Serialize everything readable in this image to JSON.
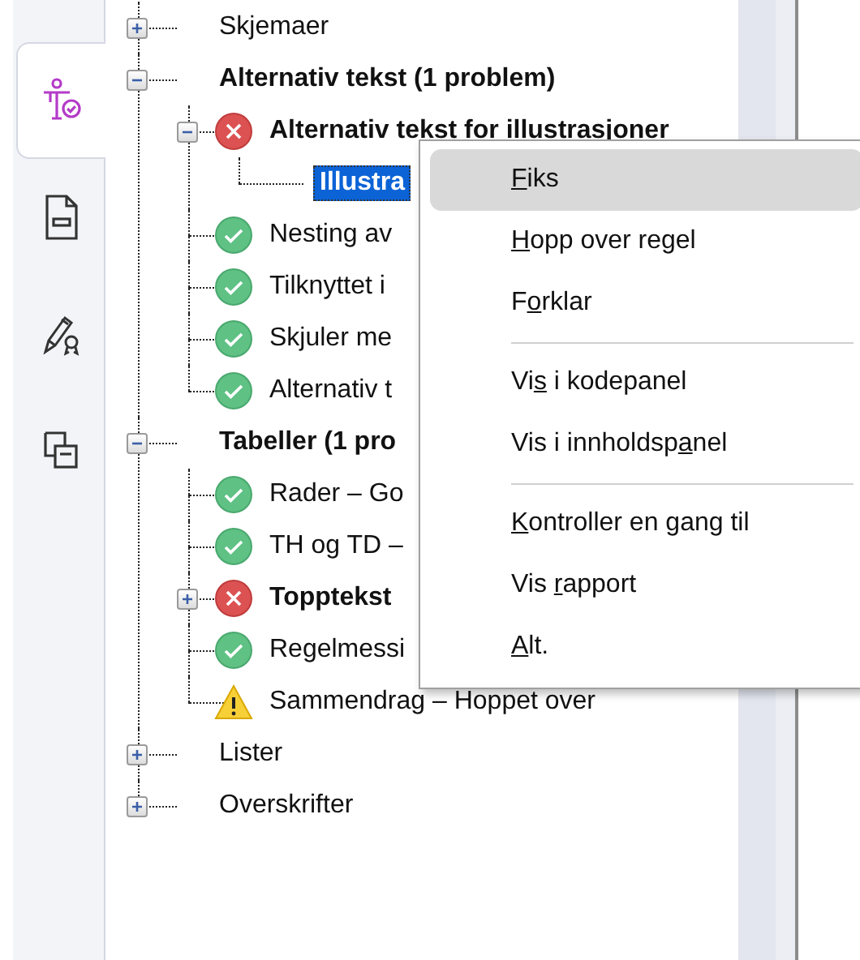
{
  "sidebar": {
    "tabs": [
      {
        "kind": "accessibility",
        "selected": true
      },
      {
        "kind": "document",
        "selected": false
      },
      {
        "kind": "signature",
        "selected": false
      },
      {
        "kind": "copy",
        "selected": false
      }
    ]
  },
  "tree": {
    "items": [
      {
        "label": "Skjemaer",
        "bold": false,
        "selected": false,
        "expanded": false
      },
      {
        "label": "Alternativ tekst (1 problem)",
        "bold": true,
        "selected": false,
        "expanded": true,
        "children": [
          {
            "label": "Alternativ tekst for illustrasjoner",
            "bold": true,
            "selected": false,
            "kind": "fail",
            "expanded": true,
            "children": [
              {
                "label": "Illustra",
                "bold": true,
                "selected": true
              }
            ]
          },
          {
            "label": "Nesting av",
            "bold": false,
            "selected": false,
            "kind": "pass"
          },
          {
            "label": "Tilknyttet i",
            "bold": false,
            "selected": false,
            "kind": "pass"
          },
          {
            "label": "Skjuler me",
            "bold": false,
            "selected": false,
            "kind": "pass"
          },
          {
            "label": "Alternativ t",
            "bold": false,
            "selected": false,
            "kind": "pass"
          }
        ]
      },
      {
        "label": "Tabeller (1 pro",
        "bold": true,
        "selected": false,
        "expanded": true,
        "children": [
          {
            "label": "Rader – Go",
            "bold": false,
            "selected": false,
            "kind": "pass"
          },
          {
            "label": "TH og TD –",
            "bold": false,
            "selected": false,
            "kind": "pass"
          },
          {
            "label": "Topptekst",
            "bold": true,
            "selected": false,
            "kind": "fail",
            "expanded": false
          },
          {
            "label": "Regelmessi",
            "bold": false,
            "selected": false,
            "kind": "pass"
          },
          {
            "label": "Sammendrag – Hoppet over",
            "bold": false,
            "selected": false,
            "kind": "warning"
          }
        ]
      },
      {
        "label": "Lister",
        "bold": false,
        "selected": false,
        "expanded": false
      },
      {
        "label": "Overskrifter",
        "bold": false,
        "selected": false,
        "expanded": false
      }
    ]
  },
  "context_menu": {
    "items": [
      {
        "kind": "item",
        "key": "F",
        "after": "iks",
        "highlighted": true
      },
      {
        "kind": "item",
        "key": "H",
        "after": "opp over regel",
        "highlighted": false
      },
      {
        "kind": "item",
        "before": "F",
        "key": "o",
        "after": "rklar",
        "highlighted": false
      },
      {
        "kind": "separator"
      },
      {
        "kind": "item",
        "before": "Vi",
        "key": "s",
        "after": " i kodepanel",
        "highlighted": false
      },
      {
        "kind": "item",
        "before": "Vis i innholdsp",
        "key": "a",
        "after": "nel",
        "highlighted": false
      },
      {
        "kind": "separator"
      },
      {
        "kind": "item",
        "key": "K",
        "after": "ontroller en gang til",
        "highlighted": false
      },
      {
        "kind": "item",
        "before": "Vis ",
        "key": "r",
        "after": "apport",
        "highlighted": false
      },
      {
        "kind": "item",
        "key": "A",
        "after": "lt.",
        "highlighted": false
      }
    ]
  }
}
